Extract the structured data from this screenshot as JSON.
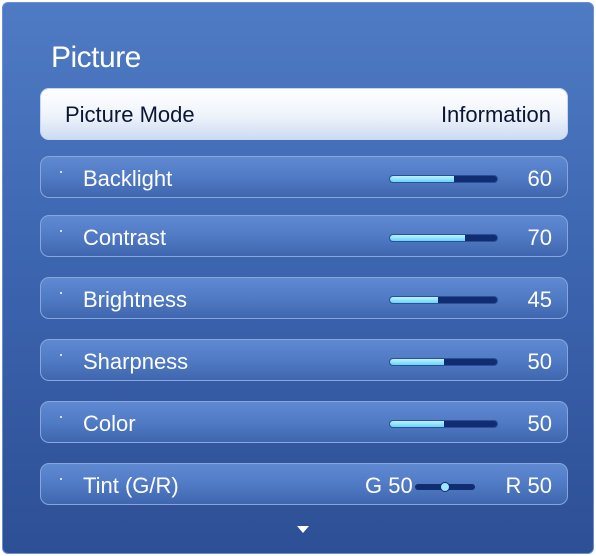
{
  "menu": {
    "title": "Picture",
    "picture_mode": {
      "label": "Picture Mode",
      "value": "Information"
    },
    "items": [
      {
        "label": "Backlight",
        "value": "60",
        "level": 0.6
      },
      {
        "label": "Contrast",
        "value": "70",
        "level": 0.7
      },
      {
        "label": "Brightness",
        "value": "45",
        "level": 0.45
      },
      {
        "label": "Sharpness",
        "value": "50",
        "level": 0.5
      },
      {
        "label": "Color",
        "value": "50",
        "level": 0.5
      }
    ],
    "tint": {
      "label": "Tint (G/R)",
      "g_value": "G 50",
      "r_value": "R 50",
      "balance": 0.5
    },
    "bullet": "·",
    "scroll_indicator": "chevron-down-icon"
  }
}
